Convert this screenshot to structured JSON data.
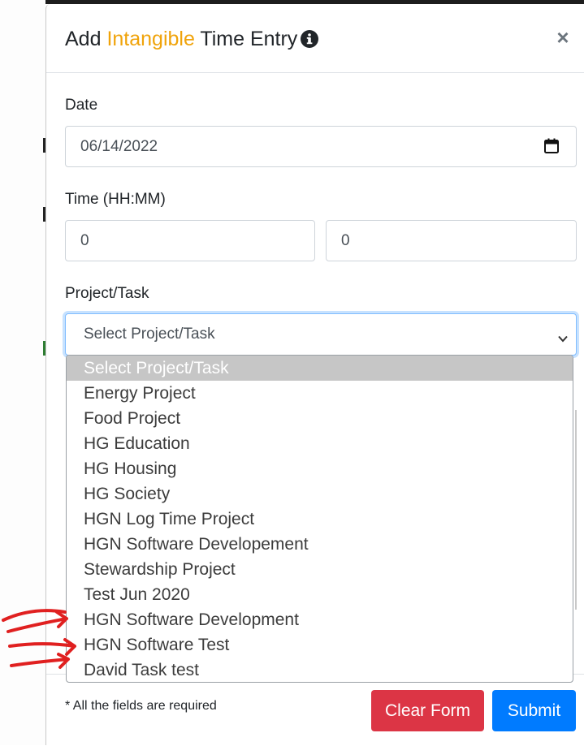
{
  "modal": {
    "title_prefix": "Add ",
    "title_accent": "Intangible",
    "title_suffix": " Time Entry",
    "close_symbol": "×"
  },
  "form": {
    "date_label": "Date",
    "date_value": "06/14/2022",
    "time_label": "Time (HH:MM)",
    "hours_value": "0",
    "minutes_value": "0",
    "project_label": "Project/Task",
    "project_selected": "Select Project/Task",
    "project_options": [
      "Select Project/Task",
      "Energy Project",
      "Food Project",
      "HG Education",
      "HG Housing",
      "HG Society",
      "HGN Log Time Project",
      "HGN Software Developement",
      "Stewardship Project",
      "Test Jun 2020",
      "HGN Software Development",
      "HGN Software Test",
      "David Task test"
    ]
  },
  "footer": {
    "required_note": "* All the fields are required",
    "clear_label": "Clear Form",
    "submit_label": "Submit"
  },
  "colors": {
    "accent": "#f0a30a",
    "clear_button": "#dc3545",
    "submit_button": "#007bff",
    "annotation": "#e02020"
  },
  "icons": {
    "title_info": "info-circle-icon",
    "date_picker": "calendar-icon",
    "select_arrow": "chevron-down-icon",
    "close": "close-icon"
  }
}
